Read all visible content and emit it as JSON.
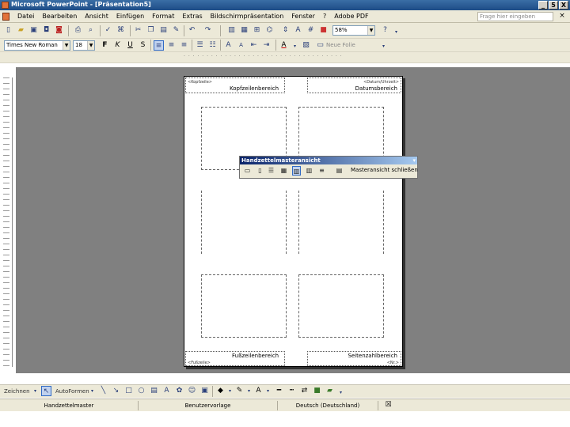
{
  "window": {
    "title": "Microsoft PowerPoint - [Präsentation5]",
    "controls": [
      "_",
      "5",
      "X"
    ]
  },
  "menubar": {
    "items": [
      "Datei",
      "Bearbeiten",
      "Ansicht",
      "Einfügen",
      "Format",
      "Extras",
      "Bildschirmpräsentation",
      "Fenster",
      "?",
      "Adobe PDF"
    ],
    "help_placeholder": "Frage hier eingeben",
    "close_glyph": "×"
  },
  "standard_toolbar": {
    "zoom_value": "58%"
  },
  "formatting_toolbar": {
    "font_value": "Times New Roman",
    "font_size_value": "18",
    "bold": "F",
    "italic": "K",
    "underline": "U",
    "new_slide_label": "Neue Folie"
  },
  "canvas": {
    "header_area_label": "Kopfzeilenbereich",
    "date_area_label": "Datumsbereich",
    "footer_area_label": "Fußzeilenbereich",
    "number_area_label": "Seitenzahlbereich",
    "header_placeholder": "<Kopfzeile>",
    "date_placeholder": "<Datum/Uhrzeit>",
    "footer_placeholder": "<Fußzeile>",
    "number_placeholder": "<Nr.>"
  },
  "handout_toolbar": {
    "title": "Handzettelmasteransicht",
    "close_label": "Masteransicht schließen"
  },
  "drawing_toolbar": {
    "draw_label": "Zeichnen",
    "autoshapes_label": "AutoFormen"
  },
  "statusbar": {
    "view": "Handzettelmaster",
    "design": "Benutzervorlage",
    "language": "Deutsch (Deutschland)"
  },
  "colors": {
    "workspace": "#808080",
    "chrome": "#ece9d8",
    "titlebar": "#1d4c86"
  }
}
